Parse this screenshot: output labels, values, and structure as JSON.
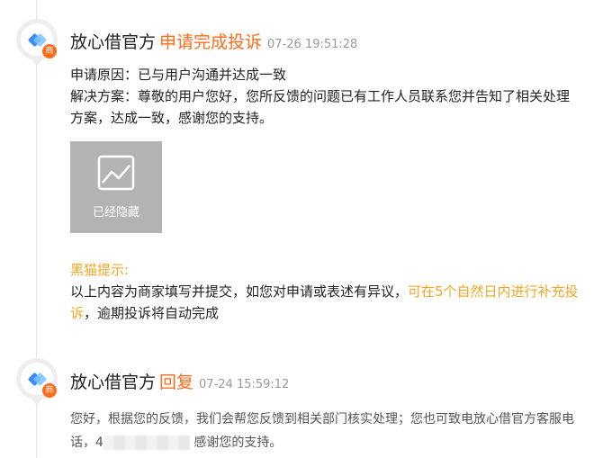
{
  "entries": [
    {
      "author": "放心借官方",
      "action": "申请完成投诉",
      "timestamp": "07-26 19:51:28",
      "badge": "商",
      "reason_label": "申请原因：",
      "reason_value": "已与用户沟通并达成一致",
      "solution_label": "解决方案：",
      "solution_value": "尊敬的用户您好，您所反馈的问题已有工作人员联系您并告知了相关处理方案，达成一致，感谢您的支持。",
      "image_label": "已经隐藏",
      "tip_title": "黑猫提示:",
      "tip_text_1": "以上内容为商家填写并提交，如您对申请或表述有异议，",
      "tip_highlight": "可在5个自然日内进行补充投诉",
      "tip_text_2": "，逾期投诉将自动完成"
    },
    {
      "author": "放心借官方",
      "action": "回复",
      "timestamp": "07-24 15:59:12",
      "badge": "商",
      "reply_text_1": "您好，根据您的反馈，我们会帮您反馈到相关部门核实处理；您也可致电放心借官方客服电话，4",
      "reply_text_2": "感谢您的支持。"
    }
  ],
  "colors": {
    "accent_orange": "#ff6b19",
    "tip_yellow": "#f5a623",
    "logo_blue": "#3d8bff"
  },
  "icons": [
    "brand-logo-icon",
    "merchant-badge-icon",
    "image-placeholder-icon"
  ]
}
